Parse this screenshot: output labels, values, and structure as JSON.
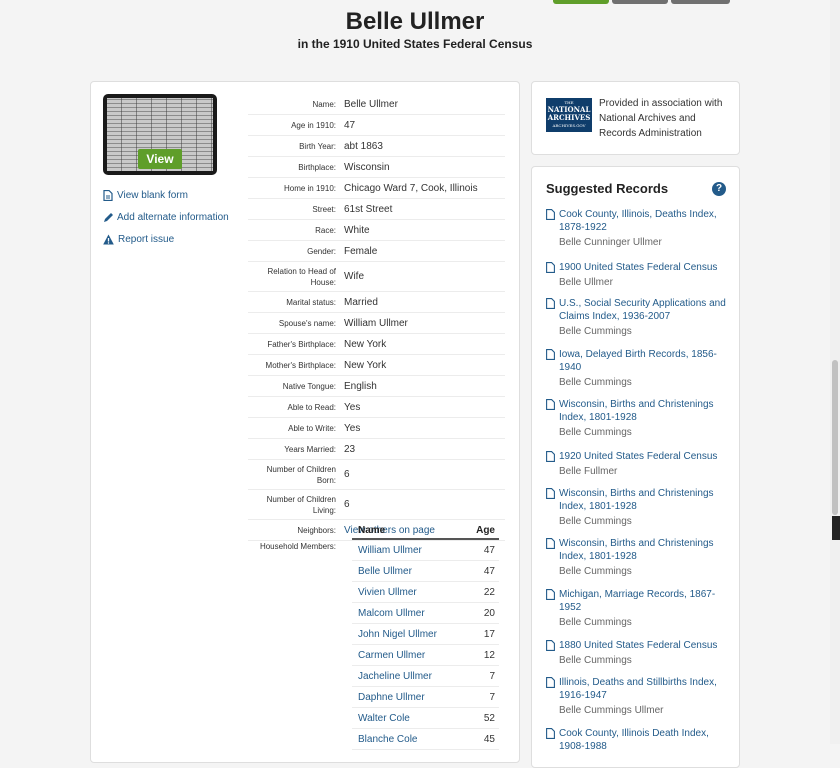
{
  "title": "Belle Ullmer",
  "subtitle": "in the 1910 United States Federal Census",
  "image_thumb": {
    "view_label": "View"
  },
  "side_links": [
    {
      "label": "View blank form",
      "icon": "document-icon"
    },
    {
      "label": "Add alternate information",
      "icon": "pencil-icon"
    },
    {
      "label": "Report issue",
      "icon": "warning-icon"
    }
  ],
  "facts": [
    {
      "label": "Name:",
      "value": "Belle Ullmer"
    },
    {
      "label": "Age in 1910:",
      "value": "47"
    },
    {
      "label": "Birth Year:",
      "value": "abt 1863"
    },
    {
      "label": "Birthplace:",
      "value": "Wisconsin"
    },
    {
      "label": "Home in 1910:",
      "value": "Chicago Ward 7, Cook, Illinois"
    },
    {
      "label": "Street:",
      "value": "61st Street"
    },
    {
      "label": "Race:",
      "value": "White"
    },
    {
      "label": "Gender:",
      "value": "Female"
    },
    {
      "label": "Relation to Head of House:",
      "value": "Wife"
    },
    {
      "label": "Marital status:",
      "value": "Married"
    },
    {
      "label": "Spouse's name:",
      "value": "William Ullmer"
    },
    {
      "label": "Father's Birthplace:",
      "value": "New York"
    },
    {
      "label": "Mother's Birthplace:",
      "value": "New York"
    },
    {
      "label": "Native Tongue:",
      "value": "English"
    },
    {
      "label": "Able to Read:",
      "value": "Yes"
    },
    {
      "label": "Able to Write:",
      "value": "Yes"
    },
    {
      "label": "Years Married:",
      "value": "23"
    },
    {
      "label": "Number of Children Born:",
      "value": "6"
    },
    {
      "label": "Number of Children Living:",
      "value": "6"
    },
    {
      "label": "Neighbors:",
      "value": "View others on page",
      "link": true
    },
    {
      "label": "Household Members:",
      "value": ""
    }
  ],
  "household": {
    "col_name": "Name",
    "col_age": "Age",
    "members": [
      {
        "name": "William Ullmer",
        "age": "47"
      },
      {
        "name": "Belle Ullmer",
        "age": "47"
      },
      {
        "name": "Vivien Ullmer",
        "age": "22"
      },
      {
        "name": "Malcom Ullmer",
        "age": "20"
      },
      {
        "name": "John Nigel Ullmer",
        "age": "17"
      },
      {
        "name": "Carmen Ullmer",
        "age": "12"
      },
      {
        "name": "Jacheline Ullmer",
        "age": "7"
      },
      {
        "name": "Daphne Ullmer",
        "age": "7"
      },
      {
        "name": "Walter Cole",
        "age": "52"
      },
      {
        "name": "Blanche Cole",
        "age": "45"
      }
    ]
  },
  "nara": {
    "logo_line1": "THE",
    "logo_line2": "NATIONAL",
    "logo_line3": "ARCHIVES",
    "logo_line4": "ARCHIVES.GOV",
    "text": "Provided in association with National Archives and Records Administration"
  },
  "suggested": {
    "title": "Suggested Records",
    "help": "?",
    "records": [
      {
        "title": "Cook County, Illinois, Deaths Index, 1878-1922",
        "person": "Belle Cunninger Ullmer"
      },
      {
        "title": "1900 United States Federal Census",
        "person": "Belle Ullmer"
      },
      {
        "title": "U.S., Social Security Applications and Claims Index, 1936-2007",
        "person": "Belle Cummings"
      },
      {
        "title": "Iowa, Delayed Birth Records, 1856-1940",
        "person": "Belle Cummings"
      },
      {
        "title": "Wisconsin, Births and Christenings Index, 1801-1928",
        "person": "Belle Cummings"
      },
      {
        "title": "1920 United States Federal Census",
        "person": "Belle Fullmer"
      },
      {
        "title": "Wisconsin, Births and Christenings Index, 1801-1928",
        "person": "Belle Cummings"
      },
      {
        "title": "Wisconsin, Births and Christenings Index, 1801-1928",
        "person": "Belle Cummings"
      },
      {
        "title": "Michigan, Marriage Records, 1867-1952",
        "person": "Belle Cummings"
      },
      {
        "title": "1880 United States Federal Census",
        "person": "Belle Cummings"
      },
      {
        "title": "Illinois, Deaths and Stillbirths Index, 1916-1947",
        "person": "Belle Cummings Ullmer"
      },
      {
        "title": "Cook County, Illinois Death Index, 1908-1988",
        "person": ""
      }
    ]
  }
}
